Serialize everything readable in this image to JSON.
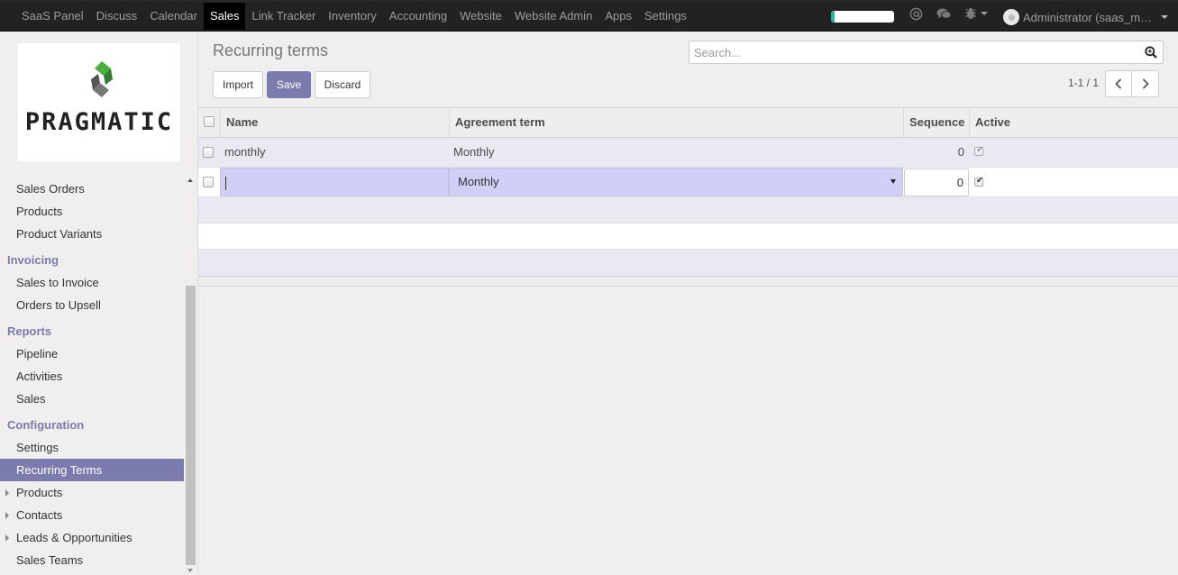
{
  "navbar": {
    "items": [
      "SaaS Panel",
      "Discuss",
      "Calendar",
      "Sales",
      "Link Tracker",
      "Inventory",
      "Accounting",
      "Website",
      "Website Admin",
      "Apps",
      "Settings"
    ],
    "active_index": 3,
    "progress_fraction": 0.05,
    "user_label": "Administrator (saas_m…",
    "icons": [
      "at-icon",
      "chat-icon",
      "bug-icon"
    ]
  },
  "sidebar": {
    "logo_text": "PRAGMATIC",
    "sections": [
      {
        "items": [
          "Sales Orders",
          "Products",
          "Product Variants"
        ]
      },
      {
        "heading": "Invoicing",
        "items": [
          "Sales to Invoice",
          "Orders to Upsell"
        ]
      },
      {
        "heading": "Reports",
        "items": [
          "Pipeline",
          "Activities",
          "Sales"
        ]
      },
      {
        "heading": "Configuration",
        "items": [
          "Settings",
          "Recurring Terms",
          "Products",
          "Contacts",
          "Leads & Opportunities",
          "Sales Teams"
        ]
      }
    ],
    "active_item": "Recurring Terms"
  },
  "control": {
    "title": "Recurring terms",
    "search_placeholder": "Search...",
    "buttons": {
      "import": "Import",
      "save": "Save",
      "discard": "Discard"
    },
    "pager": "1-1 / 1"
  },
  "table": {
    "columns": [
      "Name",
      "Agreement term",
      "Sequence",
      "Active"
    ],
    "rows": [
      {
        "name": "monthly",
        "agreement_term": "Monthly",
        "sequence": "0",
        "active": true
      }
    ],
    "edit_row": {
      "name": "",
      "agreement_term": "Monthly",
      "sequence": "0",
      "active": true
    }
  },
  "colors": {
    "accent": "#7c7bad",
    "navbar": "#222222",
    "progress": "#21b799"
  }
}
